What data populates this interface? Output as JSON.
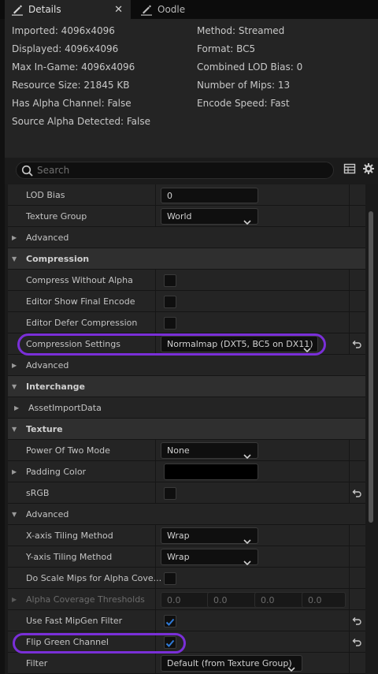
{
  "tabs": [
    {
      "label": "Details",
      "close": "✕",
      "icon": "pencil-icon"
    },
    {
      "label": "Oodle",
      "icon": "pencil-icon"
    }
  ],
  "info": {
    "left": [
      "Imported: 4096x4096",
      "Displayed: 4096x4096",
      "Max In-Game: 4096x4096",
      "Resource Size: 21845 KB",
      "Has Alpha Channel: False",
      "Source Alpha Detected: False"
    ],
    "right": [
      "Method: Streamed",
      "Format: BC5",
      "Combined LOD Bias: 0",
      "Number of Mips: 13",
      "Encode Speed: Fast"
    ]
  },
  "search": {
    "placeholder": "Search"
  },
  "toolbar_icons": [
    "table-view-icon",
    "settings-gear-icon"
  ],
  "rows": {
    "lod_bias": {
      "label": "LOD Bias",
      "value": "0"
    },
    "texture_group": {
      "label": "Texture Group",
      "value": "World"
    },
    "advanced1": {
      "label": "Advanced"
    },
    "compression": {
      "label": "Compression"
    },
    "compress_without_alpha": {
      "label": "Compress Without Alpha",
      "checked": false
    },
    "editor_show_final_encode": {
      "label": "Editor Show Final Encode",
      "checked": false
    },
    "editor_defer_compression": {
      "label": "Editor Defer Compression",
      "checked": false
    },
    "compression_settings": {
      "label": "Compression Settings",
      "value": "Normalmap (DXT5, BC5 on DX11)"
    },
    "advanced2": {
      "label": "Advanced"
    },
    "interchange": {
      "label": "Interchange"
    },
    "asset_import_data": {
      "label": "AssetImportData"
    },
    "texture": {
      "label": "Texture"
    },
    "power_of_two_mode": {
      "label": "Power Of Two Mode",
      "value": "None"
    },
    "padding_color": {
      "label": "Padding Color",
      "color": "#000000"
    },
    "srgb": {
      "label": "sRGB",
      "checked": false
    },
    "advanced3": {
      "label": "Advanced"
    },
    "x_tiling": {
      "label": "X-axis Tiling Method",
      "value": "Wrap"
    },
    "y_tiling": {
      "label": "Y-axis Tiling Method",
      "value": "Wrap"
    },
    "do_scale_mips": {
      "label": "Do Scale Mips for Alpha Cove...",
      "checked": false
    },
    "alpha_coverage": {
      "label": "Alpha Coverage Thresholds",
      "values": [
        "0.0",
        "0.0",
        "0.0",
        "0.0"
      ]
    },
    "fast_mipgen": {
      "label": "Use Fast MipGen Filter",
      "checked": true
    },
    "flip_green": {
      "label": "Flip Green Channel",
      "checked": true
    },
    "filter": {
      "label": "Filter",
      "value": "Default (from Texture Group)"
    }
  },
  "colors": {
    "highlight": "#7a2fd8",
    "checkmark": "#2f7bd9",
    "panel": "#242424",
    "category": "#2f2f2f"
  }
}
